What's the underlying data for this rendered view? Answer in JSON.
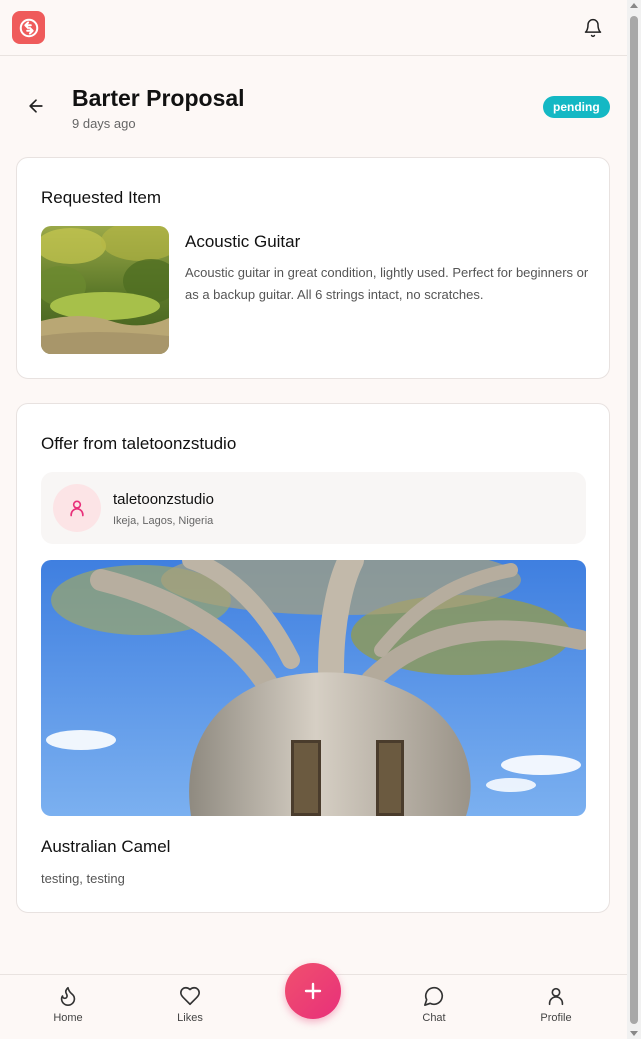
{
  "header": {
    "title": "Barter Proposal",
    "subtitle": "9 days ago",
    "status": "pending"
  },
  "requested": {
    "section_title": "Requested Item",
    "item_name": "Acoustic Guitar",
    "item_description": "Acoustic guitar in great condition, lightly used. Perfect for beginners or as a backup guitar. All 6 strings intact, no scratches."
  },
  "offer": {
    "section_title": "Offer from taletoonzstudio",
    "user_name": "taletoonzstudio",
    "user_location": "Ikeja, Lagos, Nigeria",
    "item_name": "Australian Camel",
    "item_description": "testing, testing"
  },
  "nav": {
    "home": "Home",
    "likes": "Likes",
    "chat": "Chat",
    "profile": "Profile"
  },
  "icons": {
    "logo": "swap-circle-icon",
    "notifications": "bell-icon",
    "back": "arrow-left-icon",
    "avatar": "user-icon",
    "home": "flame-icon",
    "likes": "heart-icon",
    "add": "plus-icon",
    "chat": "message-circle-icon",
    "profile": "user-icon"
  },
  "colors": {
    "brand": "#ef5b5b",
    "status_pending": "#14b8c4",
    "fab": "#e8307a",
    "avatar_bg": "#fce4e6"
  }
}
